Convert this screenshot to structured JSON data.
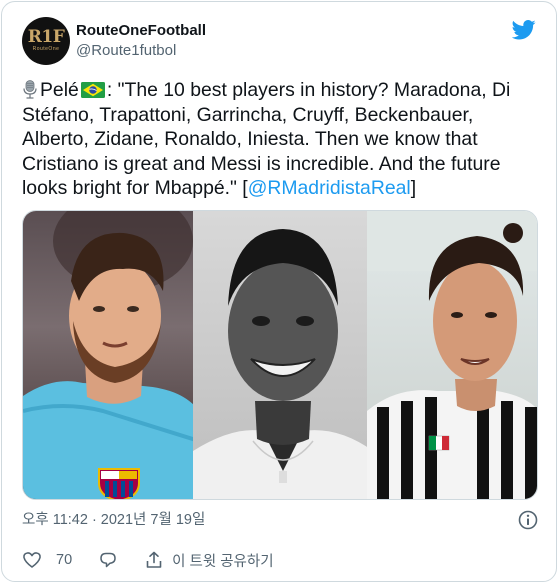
{
  "tweet": {
    "author": {
      "display_name": "RouteOneFootball",
      "handle": "@Route1futbol",
      "avatar_text": "R1F",
      "avatar_subtext": "RouteOne"
    },
    "brand_icon": "twitter-bird-icon",
    "text_before": "Pelé",
    "text_body": ": \"The 10 best players in history? Maradona, Di Stéfano, Trapattoni, Garrincha, Cruyff, Beckenbauer, Alberto, Zidane, Ronaldo, Iniesta. Then we know that Cristiano is great and Messi is incredible. And the future looks bright for Mbappé.\" [",
    "mention": "@RMadridistaReal",
    "text_after": "]",
    "timestamp": "오후 11:42 · 2021년 7월 19일",
    "likes": "70",
    "share_label": "이 트윗 공유하기"
  },
  "colors": {
    "accent": "#1d9bf0",
    "text": "#0f1419",
    "secondary": "#536471",
    "border": "#cfd9de"
  }
}
